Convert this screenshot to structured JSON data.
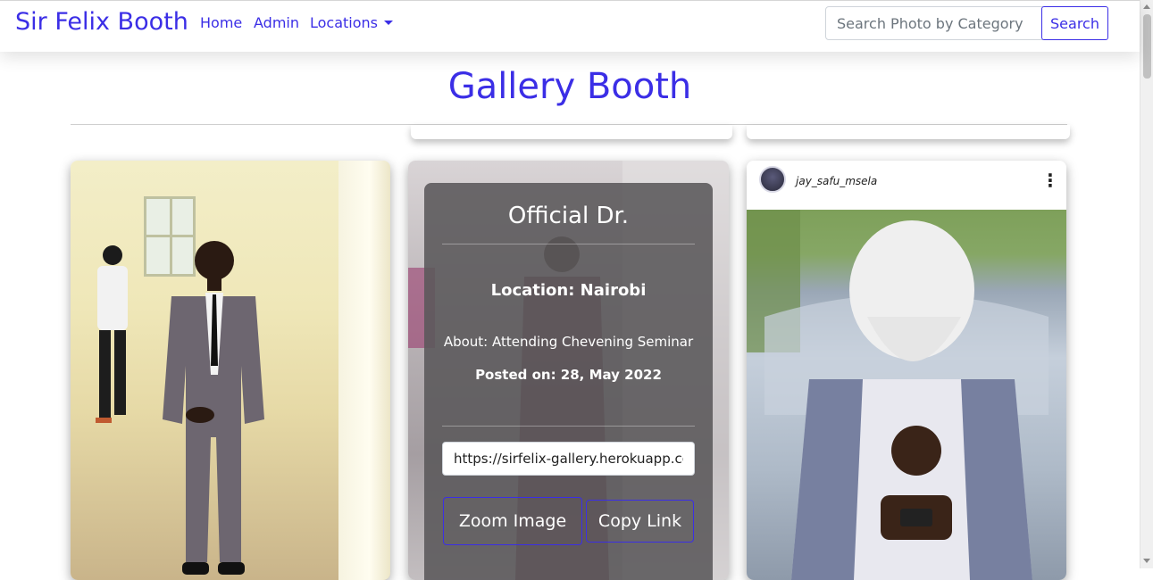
{
  "navbar": {
    "brand": "Sir Felix Booth",
    "links": {
      "home": "Home",
      "admin": "Admin",
      "locations": "Locations"
    },
    "search": {
      "placeholder": "Search Photo by Category",
      "button_label": "Search"
    }
  },
  "header": {
    "title": "Gallery Booth"
  },
  "cards": [
    {
      "image_icon": "portrait-photo"
    },
    {
      "title": "Official Dr.",
      "location": "Location: Nairobi",
      "about": "About: Attending Chevening Seminar",
      "posted": "Posted on: 28, May 2022",
      "link_value": "https://sirfelix-gallery.herokuapp.com",
      "zoom_label": "Zoom Image",
      "copy_label": "Copy Link"
    },
    {
      "username": "jay_safu_msela",
      "more_icon": "more-vertical-icon"
    }
  ],
  "colors": {
    "accent": "#3b2ee6",
    "overlay": "#5a585a"
  }
}
